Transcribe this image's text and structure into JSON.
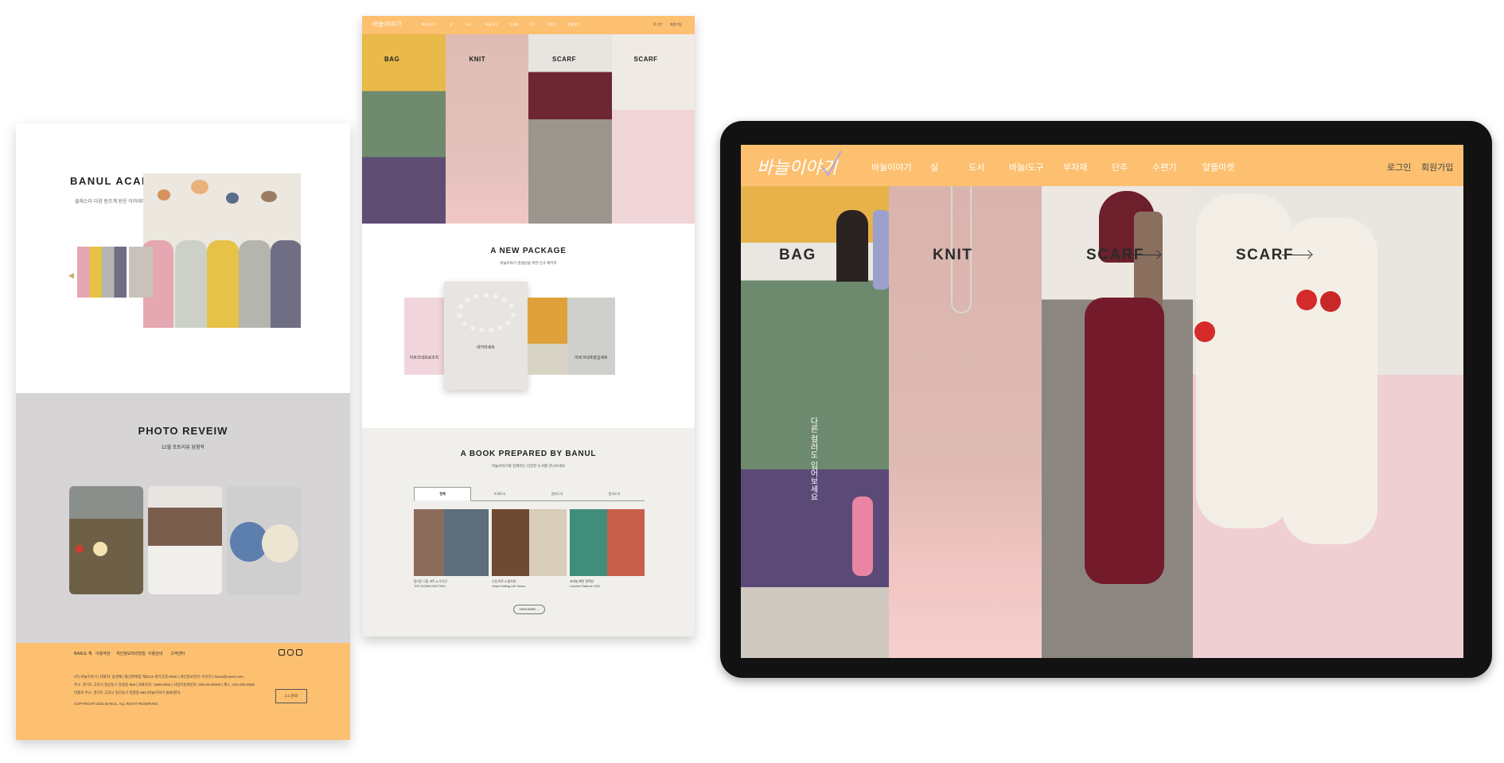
{
  "academy": {
    "title": "BANUL ACADEMY",
    "subtitle": "클래스러 다양 원조계 원운 아카데미"
  },
  "review": {
    "title": "PHOTO REVEIW",
    "subtitle": "12월 포토리뷰 당첨작"
  },
  "footer": {
    "nav": [
      "BANUL 책",
      "이용약관",
      "개인정보처리방침",
      "이용안내",
      "고객센터"
    ],
    "lines": [
      "(주) 바늘이야기 | 대표자: 송영예 | 통신판매업 제2012-경기고양-0000 | 개인정보관리: 이유진 | banul@naver.com",
      "주소: 경기도 고양시 일산동구 장항동 869 | 대표번호: 1588-0000 | 사업자등록번호: 000-00-00000 | 팩스: 031-000-0000",
      "반품지 주소: 경기도 고양시 일산동구 장항동 869 (바늘이야기 물류센터)",
      "COPYRIGHT 2021 BANUL. ALL RIGHT RESERVED."
    ],
    "button": "1:1 문의"
  },
  "mini_nav": {
    "logo": "바늘이야기",
    "items": [
      "바늘이야기",
      "실",
      "도서",
      "바늘/도구",
      "부자재",
      "단추",
      "수편기",
      "알뜰마켓"
    ],
    "auth": [
      "로그인",
      "회원가입"
    ]
  },
  "hero_labels": [
    "BAG",
    "KNIT",
    "SCARF",
    "SCARF"
  ],
  "package": {
    "title": "A NEW PACKAGE",
    "subtitle": "바늘이야기 원생님을 위한 신규 패키지",
    "items": [
      "아르크네프로조치",
      "네카라세트",
      "아르크네프장갑세트"
    ]
  },
  "book": {
    "title": "A BOOK PREPARED BY BANUL",
    "subtitle": "바늘이야기와 함께하는 다양한 도서를 만나보세요",
    "tabs": [
      "전체",
      "뜨개도서",
      "일본도서",
      "원서도서"
    ],
    "captions": [
      [
        "탑다운 니팅 코트 & 가디건",
        "TOP-DOWN KNITTING"
      ],
      [
        "니팅 하트 & 플라워",
        "Heart Knitting Life Series"
      ],
      [
        "코바늘 패턴 컬렉션",
        "Crochet Patterns 2022"
      ]
    ],
    "view_more": "VIEW MORE →"
  },
  "tablet": {
    "logo": "바늘이야기",
    "nav": [
      "바늘이야기",
      "실",
      "도서",
      "바늘/도구",
      "부자재",
      "단추",
      "수편기",
      "알뜰마켓"
    ],
    "auth": [
      "로그인",
      "회원가입"
    ],
    "hero_labels": [
      "BAG",
      "KNIT",
      "SCARF",
      "SCARF"
    ],
    "bag_caption": "다른 컬러도 입어보세요"
  },
  "colors": {
    "brand": "#fcc070",
    "review_bg": "#d6d4d5",
    "book_bg": "#f0efec"
  }
}
